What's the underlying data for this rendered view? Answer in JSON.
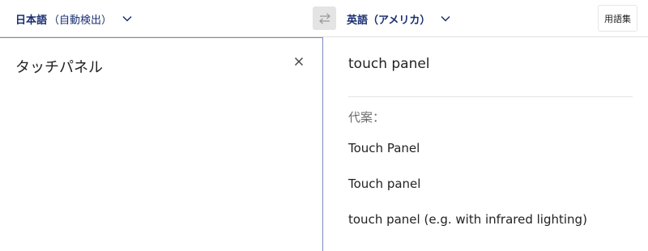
{
  "source_language": {
    "name": "日本語",
    "note": "（自動検出）"
  },
  "target_language": {
    "name": "英語（アメリカ）"
  },
  "glossary_button": "用語集",
  "source_text": "タッチパネル",
  "translation": "touch panel",
  "alternatives": {
    "heading": "代案：",
    "items": [
      "Touch Panel",
      "Touch panel",
      "touch panel (e.g. with infrared lighting)"
    ]
  },
  "icons": {
    "chevron": "chevron-down-icon",
    "swap": "swap-arrows-icon",
    "clear": "close-icon"
  },
  "colors": {
    "accent": "#1a2f72",
    "panel_border": "#7a8bbf",
    "swap_bg": "#e4e4e4"
  }
}
